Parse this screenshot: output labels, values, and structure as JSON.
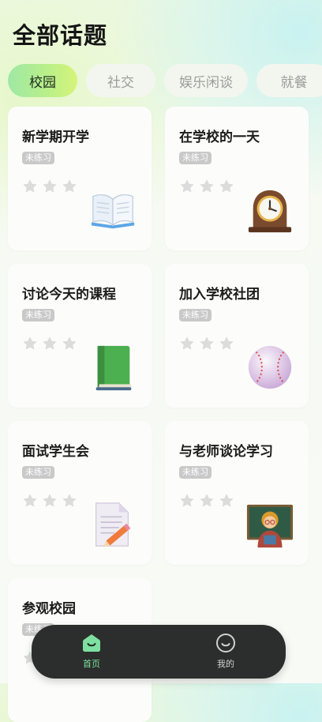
{
  "page": {
    "title": "全部话题"
  },
  "tabs": [
    {
      "label": "校园",
      "active": true
    },
    {
      "label": "社交",
      "active": false
    },
    {
      "label": "娱乐闲谈",
      "active": false
    },
    {
      "label": "就餐",
      "active": false
    }
  ],
  "cards": [
    {
      "title": "新学期开学",
      "status": "未练习",
      "stars_earned": 0,
      "stars_total": 3,
      "icon": "open-book-icon"
    },
    {
      "title": "在学校的一天",
      "status": "未练习",
      "stars_earned": 0,
      "stars_total": 3,
      "icon": "mantelpiece-clock-icon"
    },
    {
      "title": "讨论今天的课程",
      "status": "未练习",
      "stars_earned": 0,
      "stars_total": 3,
      "icon": "green-book-icon"
    },
    {
      "title": "加入学校社团",
      "status": "未练习",
      "stars_earned": 0,
      "stars_total": 3,
      "icon": "baseball-icon"
    },
    {
      "title": "面试学生会",
      "status": "未练习",
      "stars_earned": 0,
      "stars_total": 3,
      "icon": "memo-pencil-icon"
    },
    {
      "title": "与老师谈论学习",
      "status": "未练习",
      "stars_earned": 0,
      "stars_total": 3,
      "icon": "teacher-icon"
    },
    {
      "title": "参观校园",
      "status": "未练习",
      "stars_earned": 0,
      "stars_total": 3,
      "icon": ""
    }
  ],
  "nav": [
    {
      "label": "首页",
      "icon": "home-icon",
      "active": true,
      "color": "#7ee0a0"
    },
    {
      "label": "我的",
      "icon": "profile-smile-icon",
      "active": false,
      "color": "#cfd2d0"
    }
  ],
  "colors": {
    "accent": "#a8ec95",
    "badge": "#c9c9c9",
    "star": "#dcdcdc",
    "navbar": "#2b2e2c"
  }
}
